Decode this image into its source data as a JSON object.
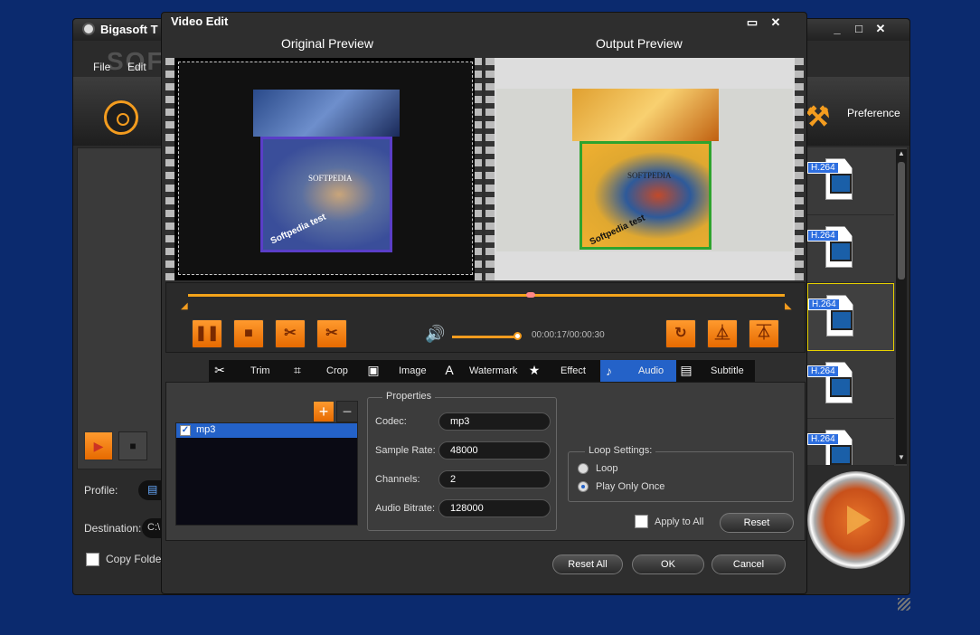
{
  "main_window": {
    "title": "Bigasoft T",
    "menu": [
      "File",
      "Edit"
    ],
    "preference_label": "Preference",
    "profile_label": "Profile:",
    "destination_label": "Destination:",
    "destination_value": "C:\\",
    "copy_folder_label": "Copy Folder",
    "file_badge": "H.264"
  },
  "watermark": "SOFTPEDIA",
  "dialog": {
    "title": "Video Edit",
    "original_preview_label": "Original Preview",
    "output_preview_label": "Output Preview",
    "preview_image_text": "SOFTPEDIA",
    "preview_image_caption": "Softpedia test",
    "time": "00:00:17/00:00:30",
    "tabs": [
      {
        "label": "Trim",
        "icon": "scissors-icon"
      },
      {
        "label": "Crop",
        "icon": "crop-icon"
      },
      {
        "label": "Image",
        "icon": "image-icon"
      },
      {
        "label": "Watermark",
        "icon": "watermark-icon"
      },
      {
        "label": "Effect",
        "icon": "star-icon"
      },
      {
        "label": "Audio",
        "icon": "music-icon"
      },
      {
        "label": "Subtitle",
        "icon": "subtitle-icon"
      }
    ],
    "active_tab": "Audio",
    "audio": {
      "add_label": "+",
      "remove_label": "−",
      "tracks": [
        "mp3"
      ],
      "properties_title": "Properties",
      "codec_label": "Codec:",
      "codec_value": "mp3",
      "sample_rate_label": "Sample Rate:",
      "sample_rate_value": "48000",
      "channels_label": "Channels:",
      "channels_value": "2",
      "bitrate_label": "Audio Bitrate:",
      "bitrate_value": "128000",
      "loop_settings_title": "Loop Settings:",
      "loop_option": "Loop",
      "play_once_option": "Play Only Once",
      "apply_all_label": "Apply to All",
      "reset_label": "Reset"
    },
    "buttons": {
      "reset_all": "Reset All",
      "ok": "OK",
      "cancel": "Cancel"
    }
  }
}
